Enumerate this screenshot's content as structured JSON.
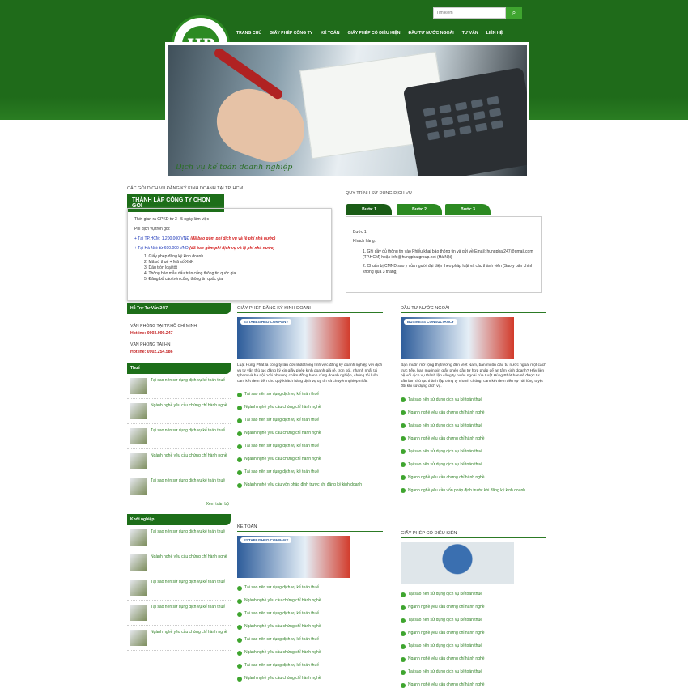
{
  "search": {
    "placeholder": "Tìm kiếm"
  },
  "nav": [
    "TRANG CHỦ",
    "GIẤY PHÉP CÔNG TY",
    "KẾ TOÁN",
    "GIẤY PHÉP CÓ ĐIỀU KIỆN",
    "ĐẦU TƯ NƯỚC NGOÀI",
    "TƯ VẤN",
    "LIÊN HỆ"
  ],
  "logo": {
    "text": "HP"
  },
  "banner": {
    "caption": "Dịch vụ kế toán doanh nghiệp"
  },
  "services": {
    "section_title": "CÁC GÓI DỊCH VỤ ĐĂNG KÝ KINH DOANH TẠI TP. HCM",
    "tab": "THÀNH LẬP CÔNG TY CHỌN GÓI",
    "time": "Thời gian ra GPKD từ 3 - 5 ngày làm việc",
    "fee_label": "Phí dịch vụ trọn gói:",
    "price_hcm_prefix": "Tại TP.HCM: 1.200.000 VNĐ",
    "price_hcm_note": "(đã bao gồm phí dịch vụ và lệ phí nhà nước)",
    "price_hn_prefix": "Tại Hà Nội: từ 600.000 VNĐ",
    "price_hn_note": "(đã bao gồm phí dịch vụ và lệ phí nhà nước)",
    "items": [
      "1. Giấy phép đăng ký kinh doanh",
      "2. Mã số thuế + Mã số XNK",
      "3. Dấu tròn loại tốt",
      "4. Thông báo mẫu dấu trên cổng thông tin quốc gia",
      "5. Đăng bố cáo trên cổng thông tin quốc gia"
    ]
  },
  "process": {
    "section_title": "QUY TRÌNH SỬ DỤNG DỊCH VỤ",
    "tabs": [
      "Bước 1",
      "Bước 2",
      "Bước 3"
    ],
    "step": "Bước 1",
    "customer": "Khách hàng:",
    "line1": "1. Ghi đầy đủ thông tin vào Phiếu khai báo thông tin và gửi về Email: hungphat247@gmail.com (TP.HCM) hoặc info@hungphatgroup.net (Hà Nội)",
    "line2": "2. Chuẩn bị CMND sao y của người đại diện theo pháp luật và các thành viên (Sao y bản chính không quá 3 tháng)"
  },
  "support": {
    "head": "Hỗ Trợ Tư Vấn 24/7",
    "office_hcm": "VĂN PHÒNG TẠI TP.HỒ CHÍ MINH",
    "hotline_hcm": "Hotline: 0903.999.247",
    "office_hn": "VĂN PHÒNG TẠI HN",
    "hotline_hn": "Hotline: 0902.254.586"
  },
  "tax": {
    "head": "Thuế",
    "items": [
      "Tại sao nên sử dụng dịch vụ kế toán thuế",
      "Ngành nghề yêu cầu chứng chỉ hành nghề",
      "Tại sao nên sử dụng dịch vụ kế toán thuế",
      "Ngành nghề yêu cầu chứng chỉ hành nghề",
      "Tại sao nên sử dụng dịch vụ kế toán thuế"
    ],
    "more": "Xem toàn bộ"
  },
  "startup": {
    "head": "Khởi nghiệp",
    "items": [
      "Tại sao nên sử dụng dịch vụ kế toán thuế",
      "Ngành nghề yêu cầu chứng chỉ hành nghề",
      "Tại sao nên sử dụng dịch vụ kế toán thuế",
      "Tại sao nên sử dụng dịch vụ kế toán thuế",
      "Ngành nghề yêu cầu chứng chỉ hành nghề"
    ]
  },
  "business_license": {
    "title": "GIẤY PHÉP ĐĂNG KÝ KINH DOANH",
    "img_label": "ESTABLISHED COMPANY",
    "desc": "Luật Hùng Phát là công ty lâu đời nhất trong lĩnh vực đăng ký doanh nghiệp với dịch vụ tư vấn thủ tục đăng ký xin giấy phép kinh doanh giá rẻ, trọn gói, nhanh nhất tại tphcm và hà nội. Với phương châm đồng hành cùng doanh nghiệp, chúng tôi luôn cam kết đem đến cho quý khách hàng dịch vụ uy tín và chuyên nghiệp nhất.",
    "items": [
      "Tại sao nên sử dụng dịch vụ kế toán thuế",
      "Ngành nghề yêu cầu chứng chỉ hành nghề",
      "Tại sao nên sử dụng dịch vụ kế toán thuế",
      "Ngành nghề yêu cầu chứng chỉ hành nghề",
      "Tại sao nên sử dụng dịch vụ kế toán thuế",
      "Ngành nghề yêu cầu chứng chỉ hành nghề",
      "Tại sao nên sử dụng dịch vụ kế toán thuế",
      "Ngành nghề yêu cầu vốn pháp định trước khi đăng ký kinh doanh"
    ]
  },
  "foreign": {
    "title": "ĐẦU TƯ NƯỚC NGOÀI",
    "img_label": "BUSINESS CONSULTANCY",
    "desc": "Bạn muốn mở rộng thị trường đến Việt Nam, bạn muốn đầu tư nước ngoài một cách trực tiếp, bạn muốn xin giấy phép đầu tư hợp pháp để an tâm kinh doanh? Hãy liên hệ với dịch vụ thành lập công ty nước ngoài của Luật Hùng Phát bạn sẽ được tư vấn làm thủ tục thành lập công ty nhanh chóng, cam kết đem đến sự hài lòng tuyệt đối khi sử dụng dịch vụ.",
    "items": [
      "Tại sao nên sử dụng dịch vụ kế toán thuế",
      "Ngành nghề yêu cầu chứng chỉ hành nghề",
      "Tại sao nên sử dụng dịch vụ kế toán thuế",
      "Ngành nghề yêu cầu chứng chỉ hành nghề",
      "Tại sao nên sử dụng dịch vụ kế toán thuế",
      "Tại sao nên sử dụng dịch vụ kế toán thuế",
      "Ngành nghề yêu cầu chứng chỉ hành nghề",
      "Ngành nghề yêu cầu vốn pháp định trước khi đăng ký kinh doanh"
    ]
  },
  "accounting": {
    "title": "KẾ TOÁN",
    "img_label": "ESTABLISHED COMPANY",
    "items": [
      "Tại sao nên sử dụng dịch vụ kế toán thuế",
      "Ngành nghề yêu cầu chứng chỉ hành nghề",
      "Tại sao nên sử dụng dịch vụ kế toán thuế",
      "Ngành nghề yêu cầu chứng chỉ hành nghề",
      "Tại sao nên sử dụng dịch vụ kế toán thuế",
      "Ngành nghề yêu cầu chứng chỉ hành nghề",
      "Tại sao nên sử dụng dịch vụ kế toán thuế",
      "Ngành nghề yêu cầu chứng chỉ hành nghề"
    ]
  },
  "conditional": {
    "title": "GIẤY PHÉP CÓ ĐIỀU KIỆN",
    "items": [
      "Tại sao nên sử dụng dịch vụ kế toán thuế",
      "Ngành nghề yêu cầu chứng chỉ hành nghề",
      "Tại sao nên sử dụng dịch vụ kế toán thuế",
      "Ngành nghề yêu cầu chứng chỉ hành nghề",
      "Tại sao nên sử dụng dịch vụ kế toán thuế",
      "Ngành nghề yêu cầu chứng chỉ hành nghề",
      "Tại sao nên sử dụng dịch vụ kế toán thuế",
      "Ngành nghề yêu cầu chứng chỉ hành nghề"
    ]
  }
}
